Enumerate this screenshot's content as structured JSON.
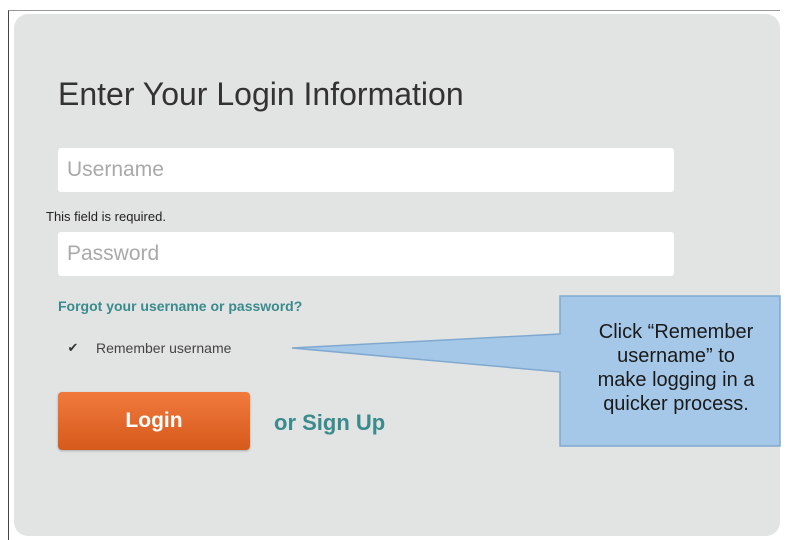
{
  "login_form": {
    "title": "Enter Your Login Information",
    "username_placeholder": "Username",
    "username_value": "",
    "required_message": "This field is required.",
    "password_placeholder": "Password",
    "password_value": "",
    "forgot_link": "Forgot your username or password?",
    "remember_label": "Remember username",
    "remember_checked": true,
    "login_button": "Login",
    "signup_prefix": "or",
    "signup_link": "Sign Up"
  },
  "callout": {
    "lines": [
      "Click “Remember",
      "username” to",
      "make logging in a",
      "quicker process."
    ]
  },
  "colors": {
    "panel_background": "#e2e3e3",
    "accent_teal": "#3a8b8d",
    "login_button_orange": "#e8692a",
    "callout_blue": "#a6c8e8"
  }
}
